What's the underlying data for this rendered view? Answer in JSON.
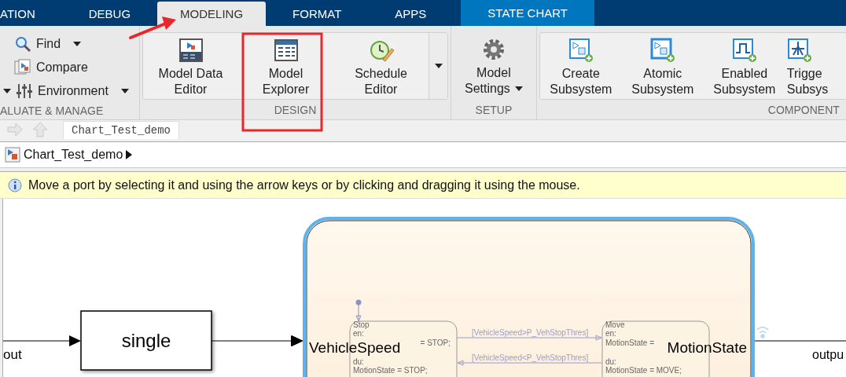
{
  "tabs": [
    {
      "label": "ATION",
      "selected": false,
      "kind": "normal"
    },
    {
      "label": "DEBUG",
      "selected": false,
      "kind": "normal"
    },
    {
      "label": "MODELING",
      "selected": true,
      "kind": "normal"
    },
    {
      "label": "FORMAT",
      "selected": false,
      "kind": "normal"
    },
    {
      "label": "APPS",
      "selected": false,
      "kind": "normal"
    },
    {
      "label": "STATE CHART",
      "selected": false,
      "kind": "contextual"
    }
  ],
  "ribbon": {
    "sections": [
      {
        "kind": "small",
        "title": "ALUATE & MANAGE",
        "items": [
          {
            "label": "Find",
            "dropdown": true,
            "leading_caret": false
          },
          {
            "label": "Compare",
            "dropdown": false,
            "leading_caret": false
          },
          {
            "label": "Environment",
            "dropdown": true,
            "leading_caret": true
          }
        ]
      },
      {
        "kind": "large",
        "title": "DESIGN",
        "framed": true,
        "more": true,
        "items": [
          {
            "lines": [
              "Model Data",
              "Editor"
            ],
            "dropdown": false
          },
          {
            "lines": [
              "Model",
              "Explorer"
            ],
            "dropdown": false
          },
          {
            "lines": [
              "Schedule",
              "Editor"
            ],
            "dropdown": false
          }
        ]
      },
      {
        "kind": "large",
        "title": "SETUP",
        "framed": false,
        "more": false,
        "items": [
          {
            "lines": [
              "Model",
              "Settings"
            ],
            "dropdown": true
          }
        ]
      },
      {
        "kind": "large",
        "title": "COMPONENT",
        "framed": true,
        "more": false,
        "items": [
          {
            "lines": [
              "Create",
              "Subsystem"
            ],
            "dropdown": false
          },
          {
            "lines": [
              "Atomic",
              "Subsystem"
            ],
            "dropdown": false
          },
          {
            "lines": [
              "Enabled",
              "Subsystem"
            ],
            "dropdown": false
          },
          {
            "lines": [
              "Trigge",
              "Subsys"
            ],
            "dropdown": false
          }
        ]
      }
    ]
  },
  "annotations": [
    {
      "kind": "arrow"
    },
    {
      "kind": "frame"
    }
  ],
  "editor_tabs": [
    {
      "label": "Chart_Test_demo",
      "selected": true
    }
  ],
  "address": {
    "path": "Chart_Test_demo"
  },
  "info": "Move a port by selecting it and using the arrow keys or by clicking and dragging it using the mouse.",
  "diagram": {
    "input_label": "out",
    "block": {
      "label": "single"
    },
    "chart": {
      "input": "VehicleSpeed",
      "output": "MotionState",
      "states": [
        {
          "name": "Stop",
          "lines": [
            {
              "text": "en:"
            },
            {
              "text": "= STOP;",
              "covered": true
            },
            {
              "text": "du:"
            },
            {
              "text": "MotionState = STOP;"
            }
          ]
        },
        {
          "name": "Move",
          "lines": [
            {
              "text": "en:"
            },
            {
              "text": "MotionState ="
            },
            {
              "text": "du:"
            },
            {
              "text": "MotionState = MOVE;"
            }
          ]
        }
      ],
      "transitions": [
        {
          "label": "[VehicleSpeed>P_VehStopThres]"
        },
        {
          "label": "[VehicleSpeed<P_VehStopThres]"
        }
      ]
    },
    "output_label": "outpu"
  }
}
